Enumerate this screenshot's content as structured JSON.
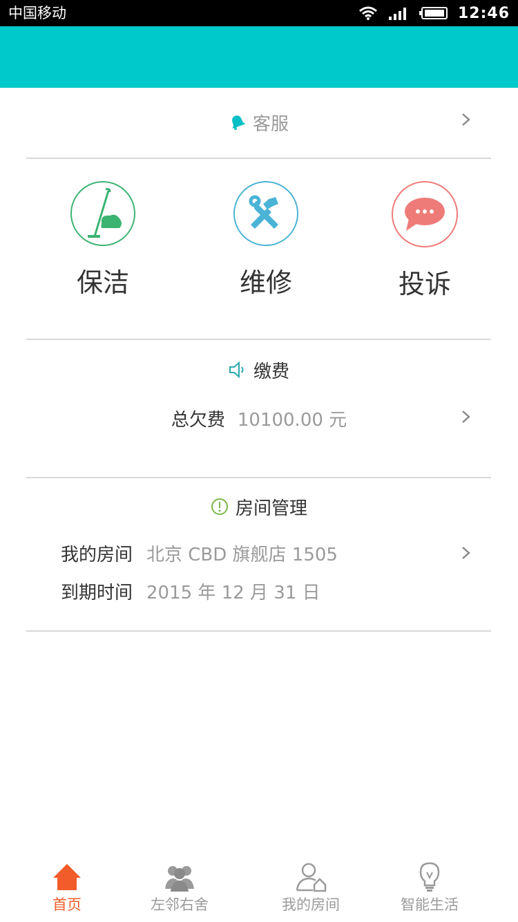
{
  "status_bar": {
    "carrier": "中国移动",
    "time": "12:46"
  },
  "service": {
    "label": "客服",
    "icon": "bell-icon"
  },
  "actions": [
    {
      "label": "保洁",
      "icon": "mop-icon",
      "color": "#3bb371"
    },
    {
      "label": "维修",
      "icon": "tools-icon",
      "color": "#4ab3d6"
    },
    {
      "label": "投诉",
      "icon": "chat-bubble-icon",
      "color": "#ee7b78"
    }
  ],
  "payment": {
    "title": "缴费",
    "title_icon": "speaker-icon",
    "total_label": "总欠费",
    "total_value": "10100.00 元"
  },
  "room": {
    "title": "房间管理",
    "title_icon": "alert-circle-icon",
    "my_room_label": "我的房间",
    "my_room_value": "北京 CBD 旗舰店 1505",
    "expire_label": "到期时间",
    "expire_value": "2015 年 12 月 31 日"
  },
  "tabbar": {
    "items": [
      {
        "label": "首页",
        "icon": "home-icon",
        "active": true
      },
      {
        "label": "左邻右舍",
        "icon": "group-icon",
        "active": false
      },
      {
        "label": "我的房间",
        "icon": "user-house-icon",
        "active": false
      },
      {
        "label": "智能生活",
        "icon": "bulb-icon",
        "active": false
      }
    ]
  },
  "colors": {
    "header": "#00c9cc",
    "accent_active": "#f25c2a",
    "tab_inactive": "#9a9a9a",
    "text_dark": "#333333",
    "text_gray": "#9a9a9a"
  }
}
